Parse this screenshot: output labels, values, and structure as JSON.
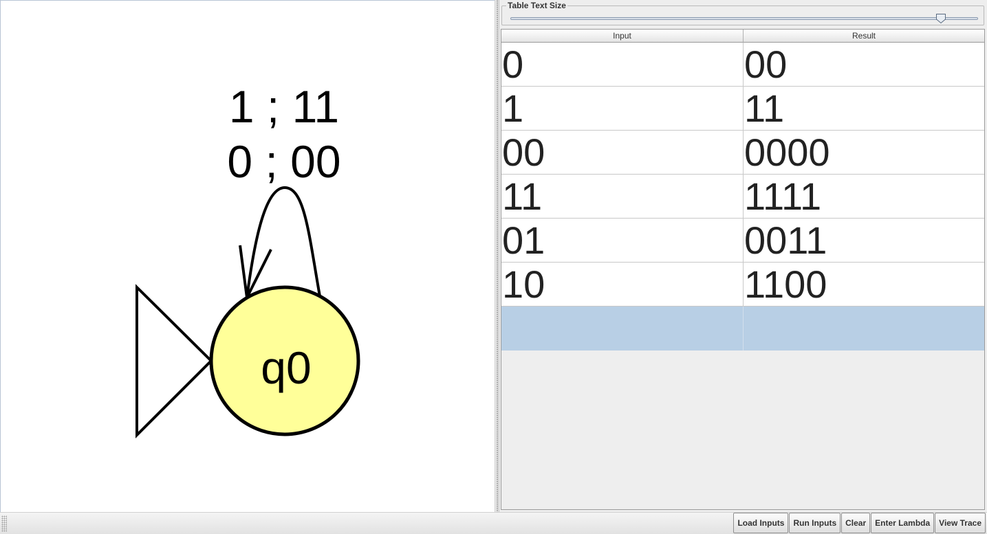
{
  "diagram": {
    "state_name": "q0",
    "state_fill": "#ffff99",
    "transition_labels": [
      "1 ; 11",
      "0 ; 00"
    ]
  },
  "text_size_panel": {
    "title": "Table Text Size",
    "slider_value_fraction": 0.92
  },
  "table": {
    "columns": [
      "Input",
      "Result"
    ],
    "rows": [
      [
        "0",
        "00"
      ],
      [
        "1",
        "11"
      ],
      [
        "00",
        "0000"
      ],
      [
        "11",
        "1111"
      ],
      [
        "01",
        "0011"
      ],
      [
        "10",
        "1100"
      ],
      [
        "",
        ""
      ]
    ],
    "selected_row_index": 6,
    "selection_color": "#b8cfe5"
  },
  "toolbar": {
    "buttons": [
      "Load Inputs",
      "Run Inputs",
      "Clear",
      "Enter Lambda",
      "View Trace"
    ]
  }
}
